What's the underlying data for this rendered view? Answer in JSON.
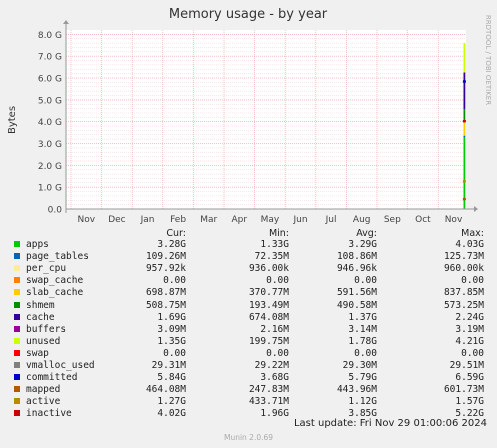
{
  "chart_data": {
    "type": "area",
    "title": "Memory usage - by year",
    "ylabel": "Bytes",
    "side_label": "RRDTOOL / TOBI OETIKER",
    "y_ticks": [
      "0.0",
      "1.0 G",
      "2.0 G",
      "3.0 G",
      "4.0 G",
      "5.0 G",
      "6.0 G",
      "7.0 G",
      "8.0 G"
    ],
    "ylim": [
      0,
      8.2
    ],
    "x_ticks": [
      "Nov",
      "Dec",
      "Jan",
      "Feb",
      "Mar",
      "Apr",
      "May",
      "Jun",
      "Jul",
      "Aug",
      "Sep",
      "Oct",
      "Nov"
    ],
    "grid": true,
    "columns": [
      "Cur:",
      "Min:",
      "Avg:",
      "Max:"
    ],
    "series": [
      {
        "name": "apps",
        "color": "#00cc00",
        "cur": "3.28G",
        "min": "1.33G",
        "avg": "3.29G",
        "max": "4.03G"
      },
      {
        "name": "page_tables",
        "color": "#0066b3",
        "cur": "109.26M",
        "min": "72.35M",
        "avg": "108.86M",
        "max": "125.73M"
      },
      {
        "name": "per_cpu",
        "color": "#ffeb99",
        "cur": "957.92k",
        "min": "936.00k",
        "avg": "946.96k",
        "max": "960.00k"
      },
      {
        "name": "swap_cache",
        "color": "#ff8000",
        "cur": "0.00",
        "min": "0.00",
        "avg": "0.00",
        "max": "0.00"
      },
      {
        "name": "slab_cache",
        "color": "#ffcc00",
        "cur": "698.87M",
        "min": "370.77M",
        "avg": "591.56M",
        "max": "837.85M"
      },
      {
        "name": "shmem",
        "color": "#008f00",
        "cur": "508.75M",
        "min": "193.49M",
        "avg": "490.58M",
        "max": "573.25M"
      },
      {
        "name": "cache",
        "color": "#330099",
        "cur": "1.69G",
        "min": "674.08M",
        "avg": "1.37G",
        "max": "2.24G"
      },
      {
        "name": "buffers",
        "color": "#990099",
        "cur": "3.09M",
        "min": "2.16M",
        "avg": "3.14M",
        "max": "3.19M"
      },
      {
        "name": "unused",
        "color": "#ccff00",
        "cur": "1.35G",
        "min": "199.75M",
        "avg": "1.78G",
        "max": "4.21G"
      },
      {
        "name": "swap",
        "color": "#ff0000",
        "cur": "0.00",
        "min": "0.00",
        "avg": "0.00",
        "max": "0.00"
      },
      {
        "name": "vmalloc_used",
        "color": "#808080",
        "cur": "29.31M",
        "min": "29.22M",
        "avg": "29.30M",
        "max": "29.51M"
      },
      {
        "name": "committed",
        "color": "#0000cc",
        "cur": "5.84G",
        "min": "3.68G",
        "avg": "5.79G",
        "max": "6.59G"
      },
      {
        "name": "mapped",
        "color": "#b35a00",
        "cur": "464.08M",
        "min": "247.83M",
        "avg": "443.96M",
        "max": "601.73M"
      },
      {
        "name": "active",
        "color": "#b38f00",
        "cur": "1.27G",
        "min": "433.71M",
        "avg": "1.12G",
        "max": "1.57G"
      },
      {
        "name": "inactive",
        "color": "#cc0000",
        "cur": "4.02G",
        "min": "1.96G",
        "avg": "3.85G",
        "max": "5.22G"
      }
    ],
    "last_update": "Last update: Fri Nov 29 01:00:06 2024",
    "footer": "Munin 2.0.69"
  }
}
